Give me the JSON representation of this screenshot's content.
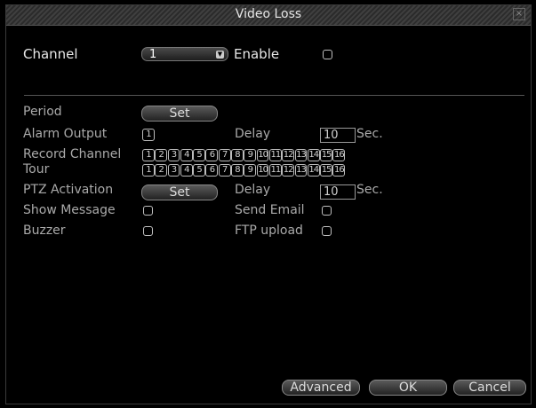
{
  "window": {
    "title": "Video Loss"
  },
  "channel": {
    "label": "Channel",
    "value": "1"
  },
  "enable": {
    "label": "Enable"
  },
  "period": {
    "label": "Period",
    "button": "Set"
  },
  "alarm_output": {
    "label": "Alarm Output",
    "value": "1"
  },
  "delay1": {
    "label": "Delay",
    "value": "10",
    "unit": "Sec."
  },
  "record_channel": {
    "label": "Record Channel",
    "channels": [
      "1",
      "2",
      "3",
      "4",
      "5",
      "6",
      "7",
      "8",
      "9",
      "10",
      "11",
      "12",
      "13",
      "14",
      "15",
      "16"
    ]
  },
  "tour": {
    "label": "Tour",
    "channels": [
      "1",
      "2",
      "3",
      "4",
      "5",
      "6",
      "7",
      "8",
      "9",
      "10",
      "11",
      "12",
      "13",
      "14",
      "15",
      "16"
    ]
  },
  "ptz": {
    "label": "PTZ Activation",
    "button": "Set"
  },
  "delay2": {
    "label": "Delay",
    "value": "10",
    "unit": "Sec."
  },
  "show_message": {
    "label": "Show Message"
  },
  "send_email": {
    "label": "Send Email"
  },
  "buzzer": {
    "label": "Buzzer"
  },
  "ftp_upload": {
    "label": "FTP upload"
  },
  "footer": {
    "advanced": "Advanced",
    "ok": "OK",
    "cancel": "Cancel"
  }
}
